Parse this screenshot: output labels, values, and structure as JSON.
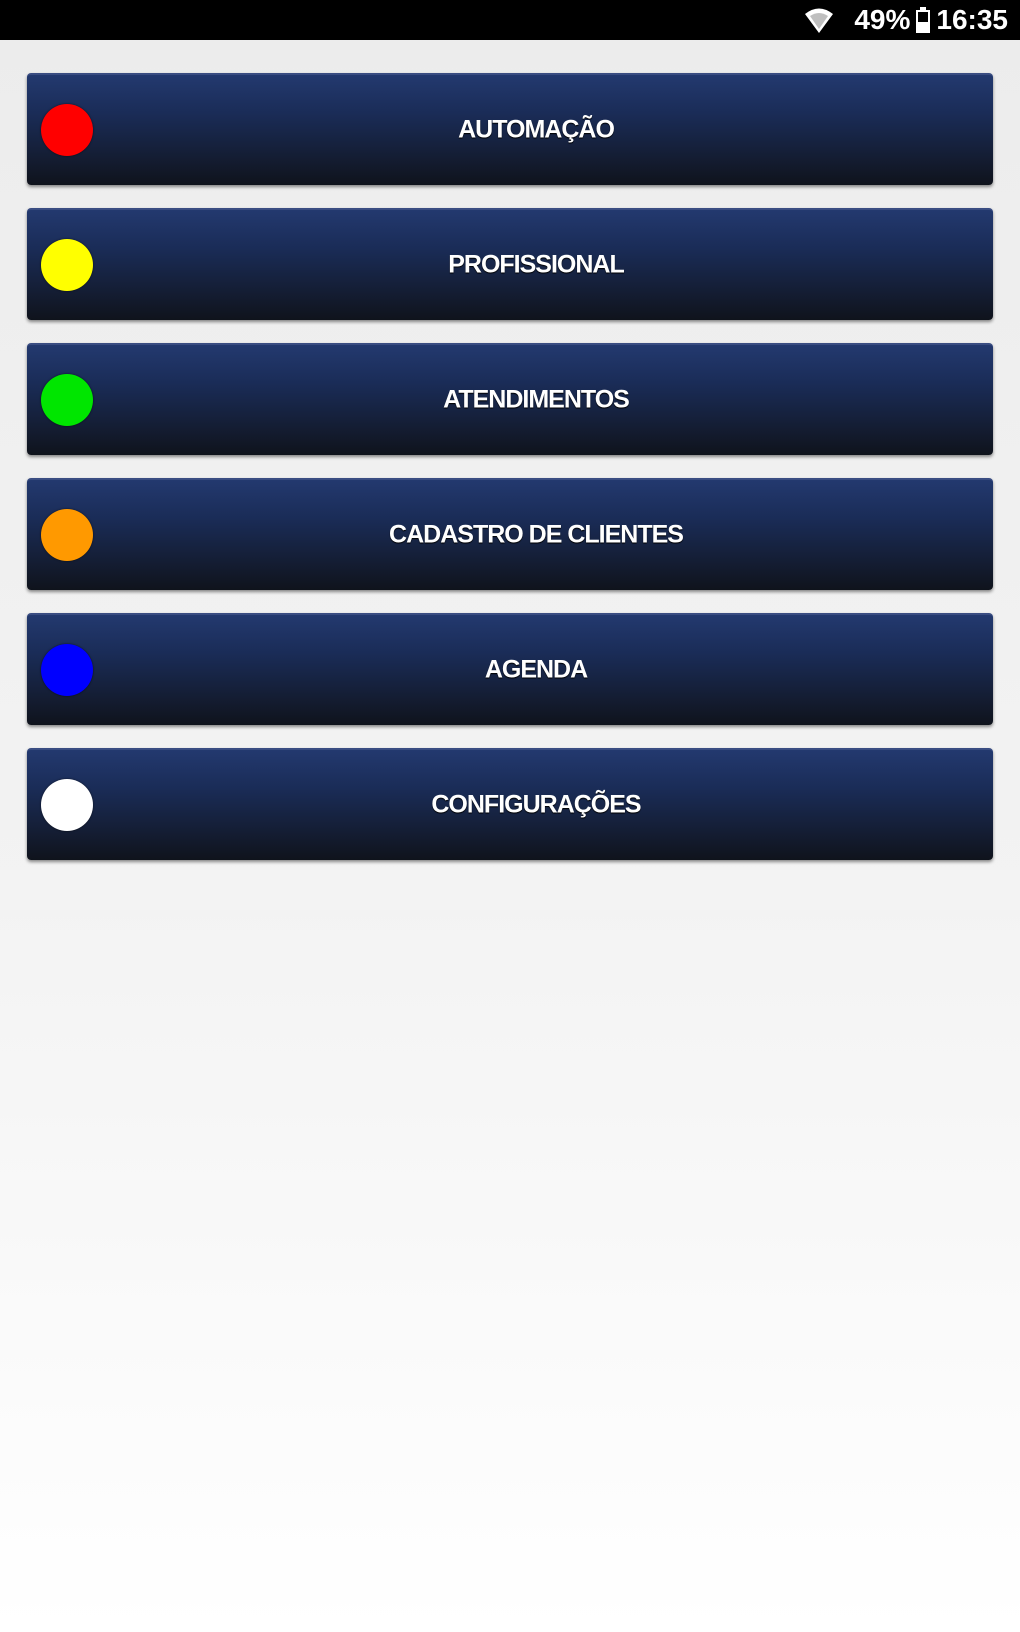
{
  "status_bar": {
    "battery_percent": "49%",
    "battery_level": 0.49,
    "time": "16:35",
    "icons": [
      "wifi-icon",
      "battery-icon"
    ]
  },
  "menu": {
    "items": [
      {
        "label": "AUTOMAÇÃO",
        "dot_color": "#ff0000",
        "icon": "red-dot-icon"
      },
      {
        "label": "PROFISSIONAL",
        "dot_color": "#ffff00",
        "icon": "yellow-dot-icon"
      },
      {
        "label": "ATENDIMENTOS",
        "dot_color": "#00e600",
        "icon": "green-dot-icon"
      },
      {
        "label": "CADASTRO DE CLIENTES",
        "dot_color": "#ff9900",
        "icon": "orange-dot-icon"
      },
      {
        "label": "AGENDA",
        "dot_color": "#0000ff",
        "icon": "blue-dot-icon"
      },
      {
        "label": "CONFIGURAÇÕES",
        "dot_color": "#ffffff",
        "icon": "white-dot-icon"
      }
    ]
  },
  "colors": {
    "status_bar_bg": "#000000",
    "button_top": "#23396f",
    "button_bottom": "#0f131c",
    "background": "#f3f3f3"
  }
}
